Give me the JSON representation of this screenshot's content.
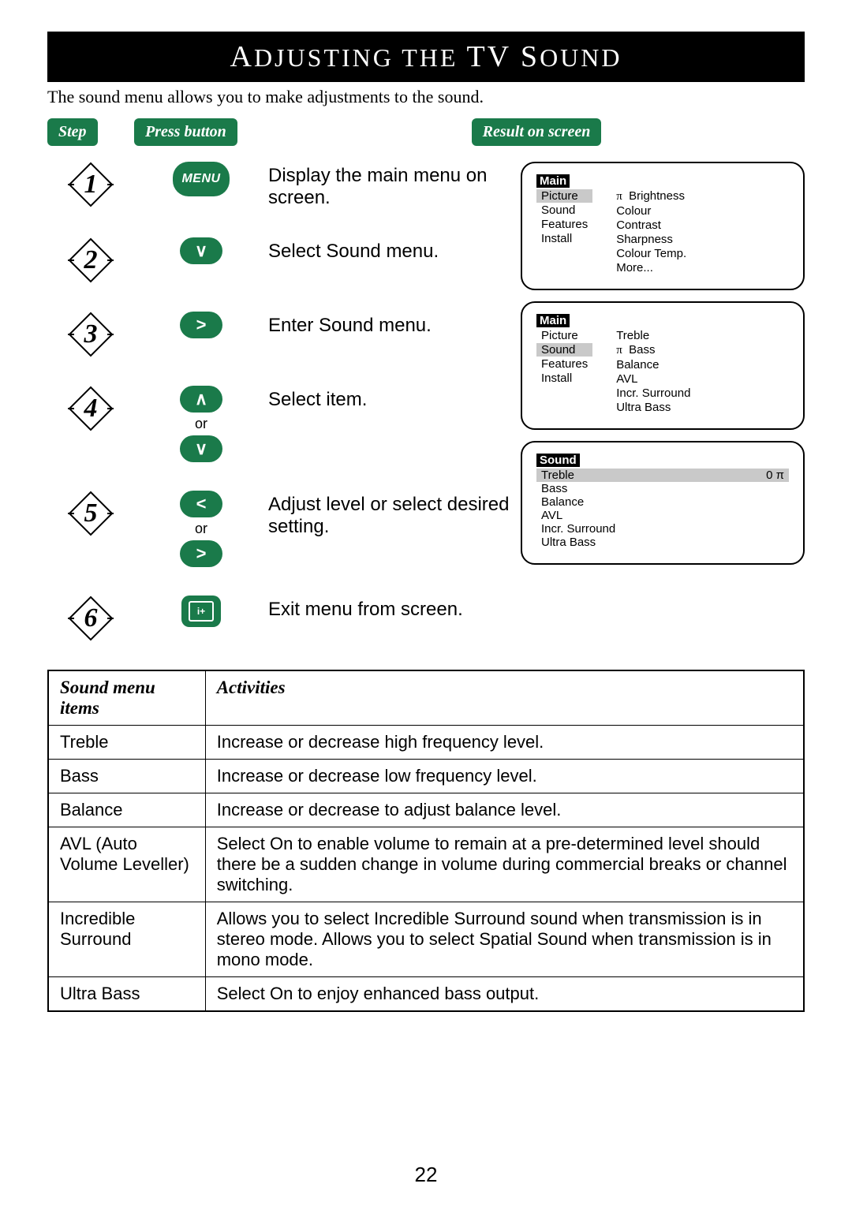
{
  "title_prefix": "A",
  "title_mid": "DJUSTING THE",
  "title_tv": "TV S",
  "title_end": "OUND",
  "intro": "The sound menu allows you to make adjustments to the sound.",
  "headers": {
    "step": "Step",
    "press": "Press button",
    "result": "Result on screen"
  },
  "steps": [
    {
      "n": "1",
      "btn_type": "menu",
      "btn_label": "MENU",
      "desc": "Display the main menu on screen."
    },
    {
      "n": "2",
      "btn_type": "down",
      "desc": "Select Sound menu."
    },
    {
      "n": "3",
      "btn_type": "right",
      "desc": "Enter Sound menu."
    },
    {
      "n": "4",
      "btn_type": "updown",
      "desc": "Select item."
    },
    {
      "n": "5",
      "btn_type": "leftright",
      "desc": "Adjust level or select desired setting."
    },
    {
      "n": "6",
      "btn_type": "exit",
      "desc": "Exit menu from screen."
    }
  ],
  "or_label": "or",
  "osd1": {
    "title": "Main",
    "left": [
      "Picture",
      "Sound",
      "Features",
      "Install"
    ],
    "left_hl_index": 0,
    "right": [
      "Brightness",
      "Colour",
      "Contrast",
      "Sharpness",
      "Colour Temp.",
      "More..."
    ],
    "right_prefix_pi_index": 0
  },
  "osd2": {
    "title": "Main",
    "left": [
      "Picture",
      "Sound",
      "Features",
      "Install"
    ],
    "left_hl_index": 1,
    "right": [
      "Treble",
      "Bass",
      "Balance",
      "AVL",
      "Incr. Surround",
      "Ultra Bass"
    ],
    "right_prefix_pi_index": 1
  },
  "osd3": {
    "title": "Sound",
    "rows": [
      {
        "label": "Treble",
        "value": "0 π",
        "hl": true
      },
      {
        "label": "Bass"
      },
      {
        "label": "Balance"
      },
      {
        "label": "AVL"
      },
      {
        "label": "Incr. Surround"
      },
      {
        "label": "Ultra Bass"
      }
    ]
  },
  "table": {
    "h1": "Sound menu items",
    "h2": "Activities",
    "rows": [
      {
        "a": "Treble",
        "b": "Increase or decrease high frequency level."
      },
      {
        "a": "Bass",
        "b": "Increase or decrease low frequency level."
      },
      {
        "a": "Balance",
        "b": "Increase or decrease to adjust balance level."
      },
      {
        "a": "AVL (Auto Volume Leveller)",
        "b": "Select On to enable volume to remain at a pre-determined level should there be a sudden change in volume during commercial breaks or channel switching."
      },
      {
        "a": "Incredible Surround",
        "b": "Allows you to select Incredible Surround sound when transmission is in stereo mode. Allows you to select Spatial Sound when transmission is in mono mode."
      },
      {
        "a": "Ultra Bass",
        "b": "Select On to enjoy enhanced bass output."
      }
    ]
  },
  "page_number": "22"
}
